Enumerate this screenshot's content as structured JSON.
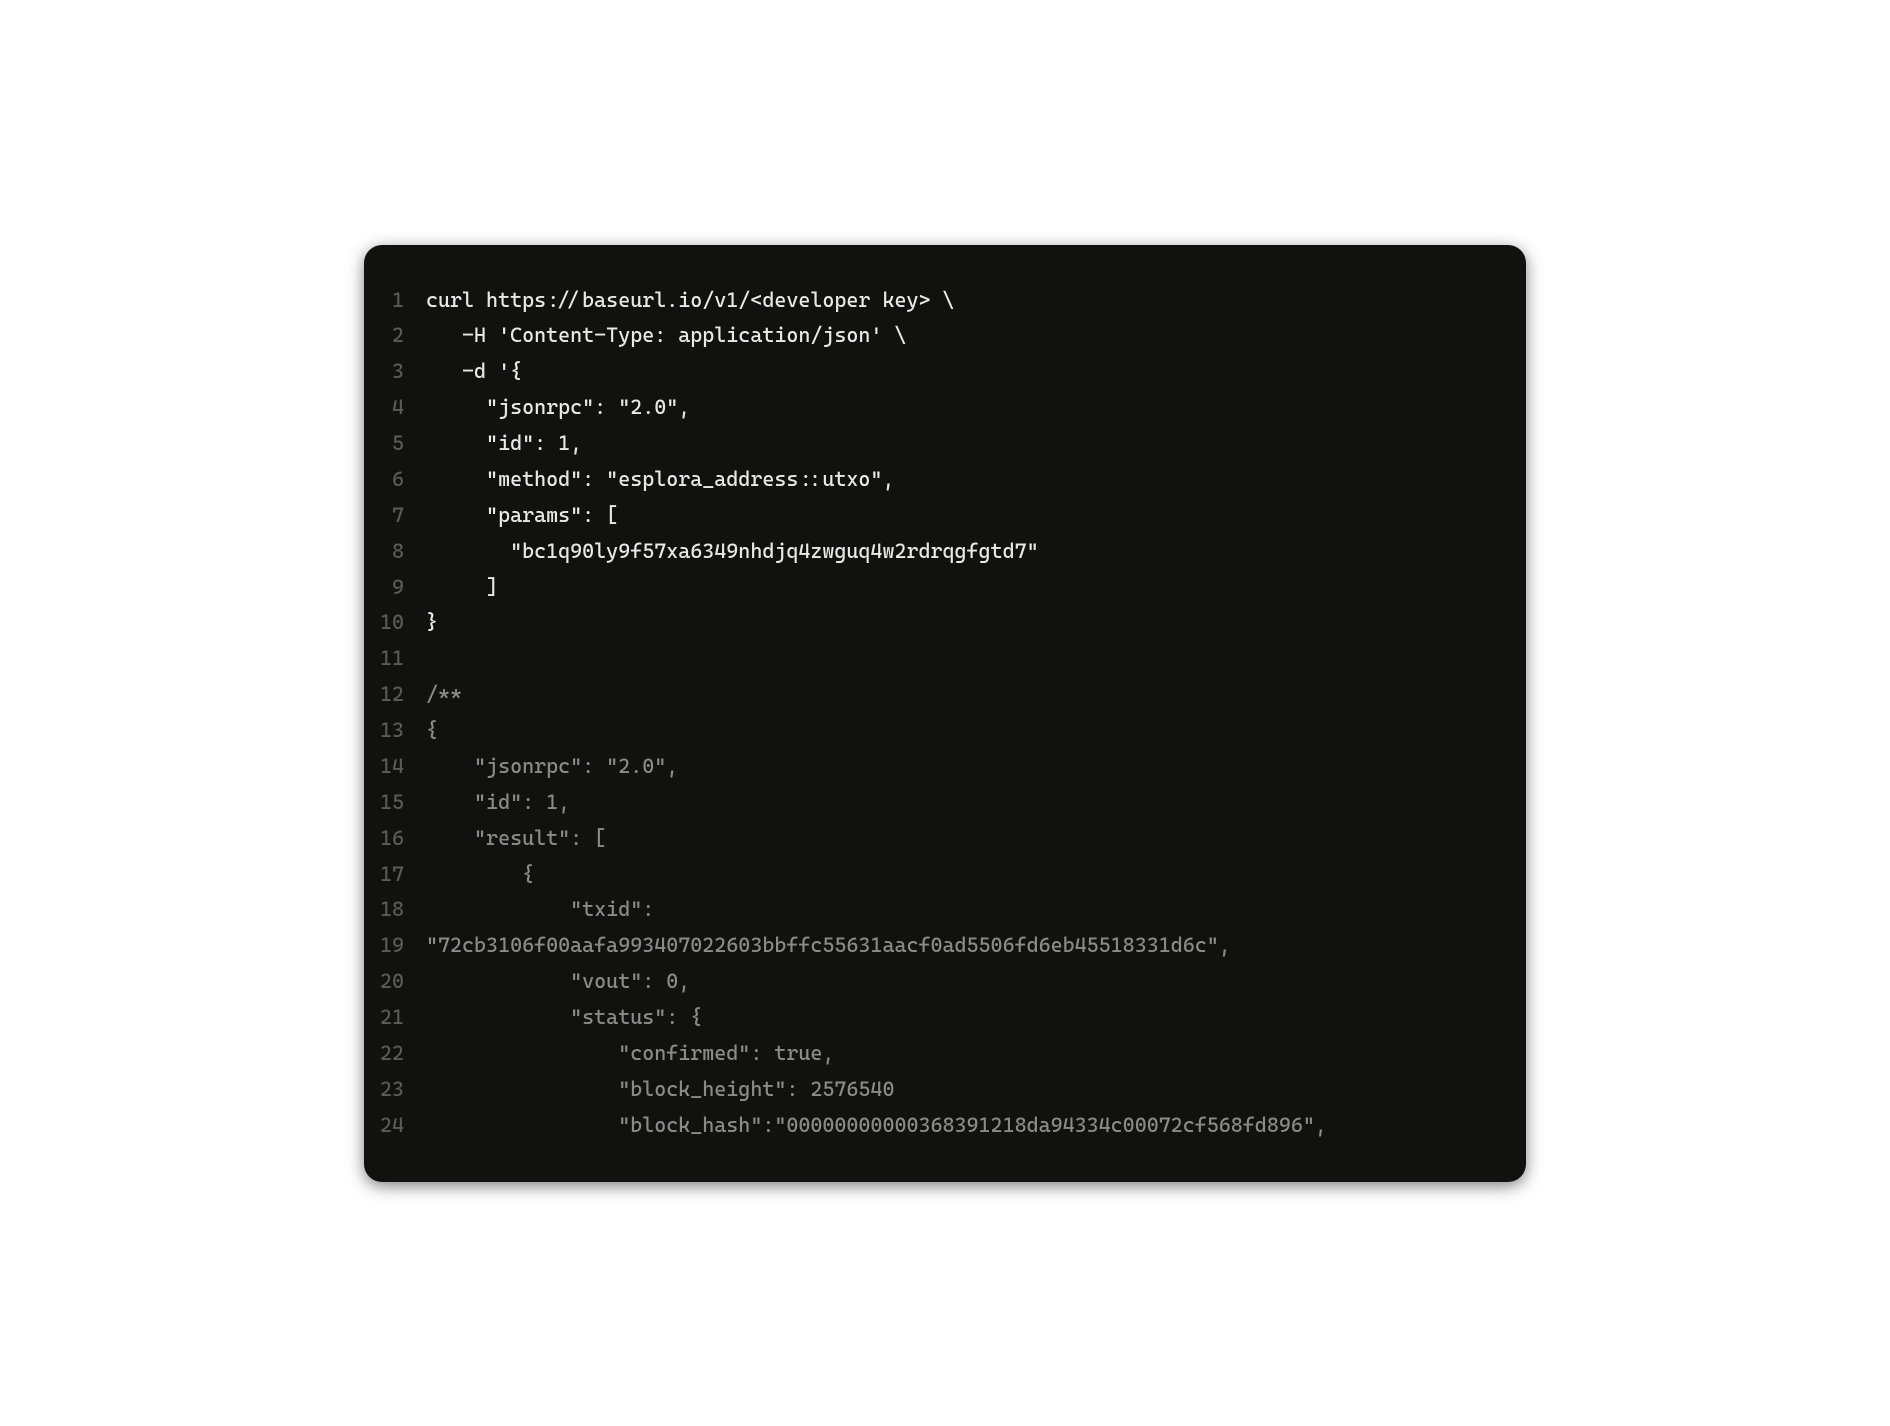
{
  "colors": {
    "background": "#111110",
    "gutter": "#5a5a58",
    "text_primary": "#e8e8e6",
    "text_dim": "#8a8a86"
  },
  "code": {
    "lines": [
      {
        "num": "1",
        "dim": false,
        "text": "curl https://baseurl.io/v1/<developer key> \\"
      },
      {
        "num": "2",
        "dim": false,
        "text": "   -H 'Content-Type: application/json' \\"
      },
      {
        "num": "3",
        "dim": false,
        "text": "   -d '{"
      },
      {
        "num": "4",
        "dim": false,
        "text": "     \"jsonrpc\": \"2.0\","
      },
      {
        "num": "5",
        "dim": false,
        "text": "     \"id\": 1,"
      },
      {
        "num": "6",
        "dim": false,
        "text": "     \"method\": \"esplora_address::utxo\","
      },
      {
        "num": "7",
        "dim": false,
        "text": "     \"params\": ["
      },
      {
        "num": "8",
        "dim": false,
        "text": "       \"bc1q90ly9f57xa6349nhdjq4zwguq4w2rdrqgfgtd7\""
      },
      {
        "num": "9",
        "dim": false,
        "text": "     ]"
      },
      {
        "num": "10",
        "dim": false,
        "text": "}"
      },
      {
        "num": "11",
        "dim": false,
        "text": ""
      },
      {
        "num": "12",
        "dim": true,
        "text": "/**"
      },
      {
        "num": "13",
        "dim": true,
        "text": "{"
      },
      {
        "num": "14",
        "dim": true,
        "text": "    \"jsonrpc\": \"2.0\","
      },
      {
        "num": "15",
        "dim": true,
        "text": "    \"id\": 1,"
      },
      {
        "num": "16",
        "dim": true,
        "text": "    \"result\": ["
      },
      {
        "num": "17",
        "dim": true,
        "text": "        {"
      },
      {
        "num": "18",
        "dim": true,
        "text": "            \"txid\":"
      },
      {
        "num": "19",
        "dim": true,
        "text": "\"72cb3106f00aafa993407022603bbffc55631aacf0ad5506fd6eb45518331d6c\","
      },
      {
        "num": "20",
        "dim": true,
        "text": "            \"vout\": 0,"
      },
      {
        "num": "21",
        "dim": true,
        "text": "            \"status\": {"
      },
      {
        "num": "22",
        "dim": true,
        "text": "                \"confirmed\": true,"
      },
      {
        "num": "23",
        "dim": true,
        "text": "                \"block_height\": 2576540"
      },
      {
        "num": "24",
        "dim": true,
        "text": "                \"block_hash\":\"00000000000368391218da94334c00072cf568fd896\","
      }
    ]
  }
}
